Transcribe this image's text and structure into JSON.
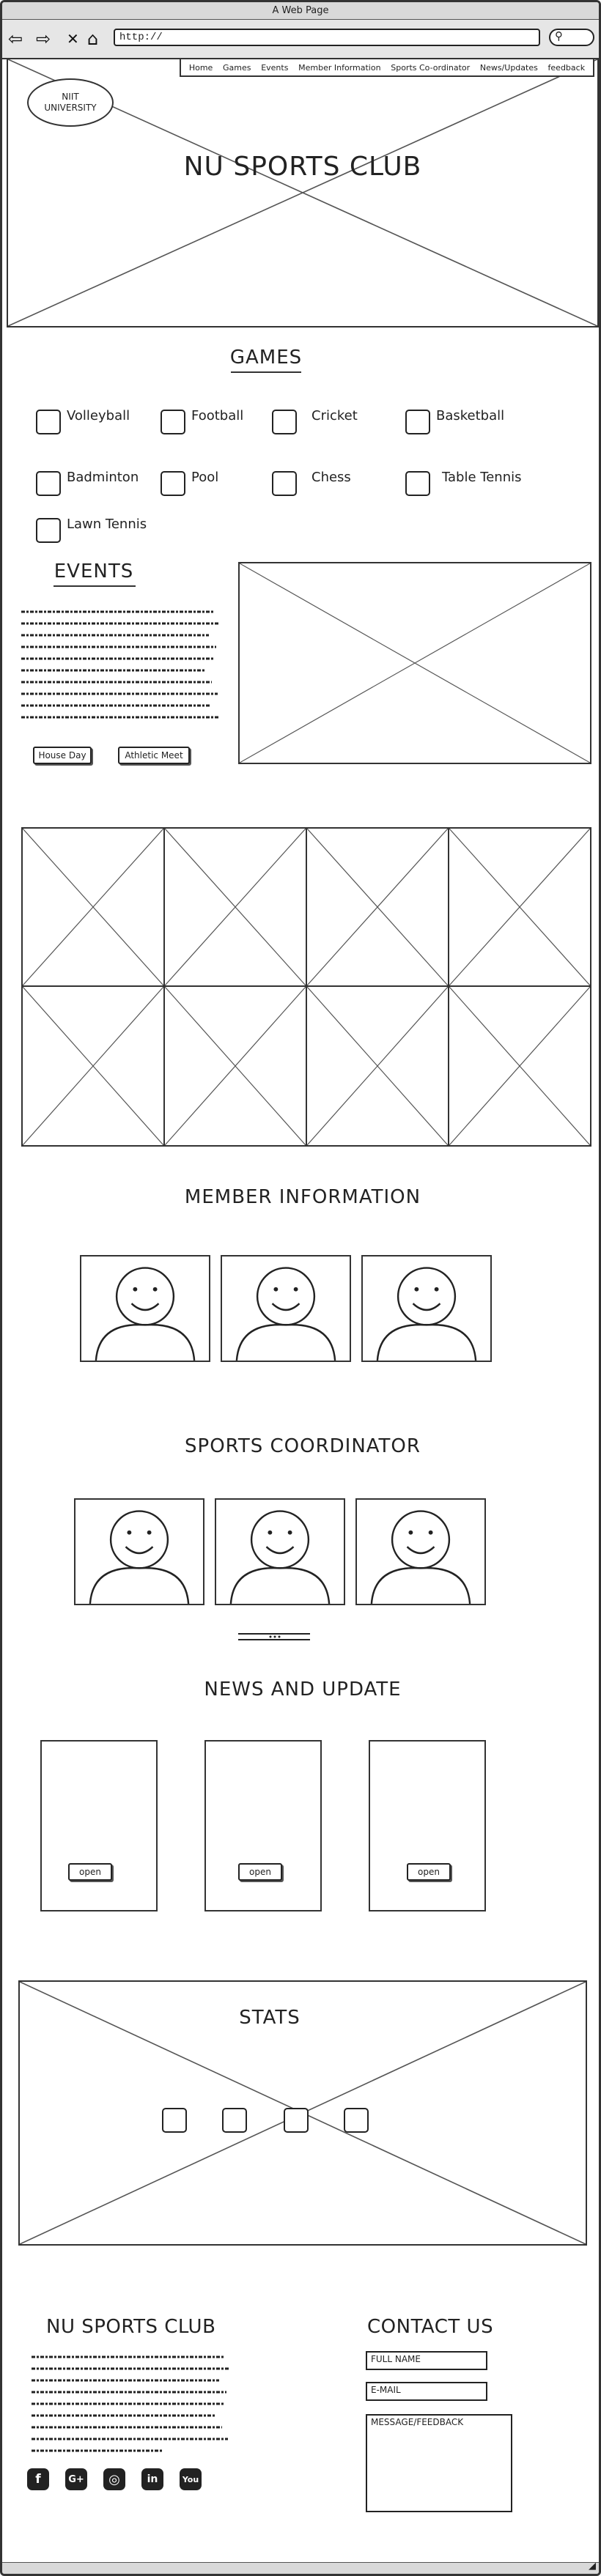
{
  "window": {
    "title": "A Web Page"
  },
  "browser": {
    "back_glyph": "⇦",
    "forward_glyph": "⇨",
    "close_glyph": "✕",
    "home_glyph": "⌂",
    "url": "http://",
    "search_glyph": "⚲",
    "resize_glyph": "◢"
  },
  "nav": {
    "items": [
      "Home",
      "Games",
      "Events",
      "Member Information",
      "Sports Co-ordinator",
      "News/Updates",
      "feedback"
    ]
  },
  "hero": {
    "logo_text": "NIIT\nUNIVERSITY",
    "title": "NU SPORTS CLUB"
  },
  "games": {
    "heading": "GAMES",
    "items": [
      "Volleyball",
      "Football",
      "Cricket",
      "Basketball",
      "Badminton",
      "Pool",
      "Chess",
      "Table Tennis",
      "Lawn Tennis"
    ]
  },
  "events": {
    "heading": "EVENTS",
    "buttons": [
      "House Day",
      "Athletic Meet"
    ]
  },
  "members": {
    "heading": "MEMBER INFORMATION"
  },
  "coordinators": {
    "heading": "SPORTS COORDINATOR"
  },
  "news": {
    "heading": "NEWS AND UPDATE",
    "cards": [
      {
        "button": "open"
      },
      {
        "button": "open"
      },
      {
        "button": "open"
      }
    ]
  },
  "stats": {
    "heading": "STATS"
  },
  "footer": {
    "club_title": "NU SPORTS CLUB",
    "contact_title": "CONTACT US",
    "fullname_placeholder": "FULL NAME",
    "email_placeholder": "E-MAIL",
    "message_placeholder": "MESSAGE/FEEDBACK",
    "social": [
      "facebook-icon",
      "google-plus-icon",
      "instagram-icon",
      "linkedin-icon",
      "youtube-icon"
    ],
    "social_glyphs": [
      "f",
      "G+",
      "◎",
      "in",
      "You"
    ]
  }
}
